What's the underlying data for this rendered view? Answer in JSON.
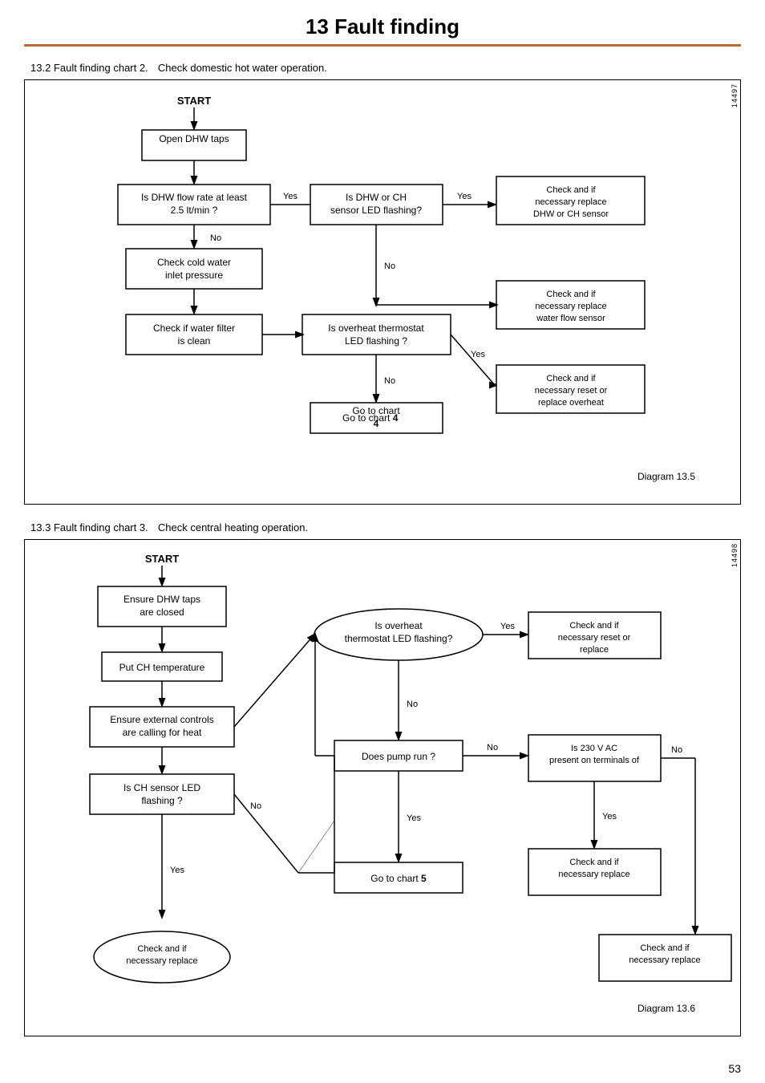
{
  "page": {
    "title": "13  Fault finding",
    "number": "53"
  },
  "section2": {
    "heading": "13.2 Fault finding chart 2.",
    "subtitle": "Check domestic hot water operation.",
    "diagram_label": "Diagram 13.5",
    "side_number": "14497",
    "nodes": {
      "start": "START",
      "open_dhw": "Open DHW taps",
      "dhw_flow": "Is DHW flow rate at least\n2.5 lt/min ?",
      "check_cold": "Check cold water\ninlet pressure",
      "check_filter": "Check if water filter\nis clean",
      "dhw_ch_sensor": "Is DHW or CH\nsensor LED flashing?",
      "check_dhw_ch": "Check and if\nnecessary replace\nDHW or CH sensor",
      "check_water_flow": "Check and if\nnecessary replace\nwater flow sensor",
      "overheat_thermo": "Is overheat thermostat\nLED flashing ?",
      "check_overheat": "Check and if\nnecessary reset or\nreplace overheat",
      "go_chart4": "Go to chart  4",
      "yes": "Yes",
      "no": "No"
    }
  },
  "section3": {
    "heading": "13.3 Fault finding chart 3.",
    "subtitle": "Check central heating operation.",
    "diagram_label": "Diagram 13.6",
    "side_number": "14498",
    "nodes": {
      "start": "START",
      "ensure_dhw": "Ensure DHW taps\nare closed",
      "put_ch": "Put CH temperature",
      "ensure_controls": "Ensure external controls\nare calling for heat",
      "ch_sensor_led": "Is CH sensor LED\nflashing ?",
      "check_replace1": "Check and if\nnecessary replace",
      "overheat_led": "Is overheat\nthermostat LED flashing?",
      "check_reset": "Check and if\nnecessary reset or\nreplace",
      "pump_run": "Does pump run ?",
      "go_chart5": "Go to chart  5",
      "is_230vac": "Is 230 V AC\npresent on terminals of",
      "check_replace2": "Check and if\nnecessary replace",
      "check_replace3": "Check and if\nnecessary replace"
    }
  }
}
